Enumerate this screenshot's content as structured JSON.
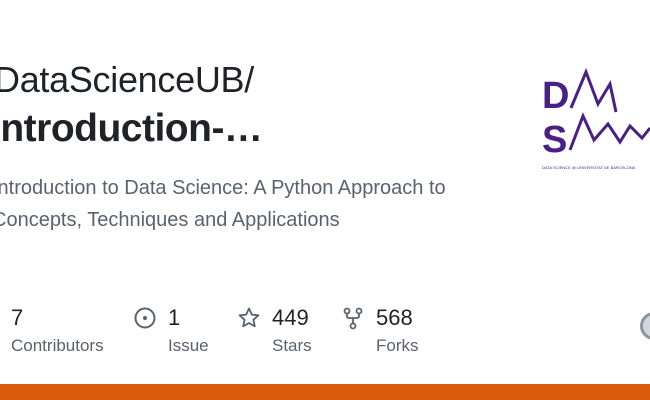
{
  "repo": {
    "owner": "DataScienceUB/",
    "name": "Introduction-…",
    "description": "Introduction to Data Science: A Python Approach to Concepts, Techniques and Applications"
  },
  "logo": {
    "letters": [
      "D",
      "S"
    ],
    "caption": "DATA SCIENCE @ UNIVERSITAT DE BARCELONA",
    "color": "#4a1f86"
  },
  "stats": [
    {
      "value": "7",
      "label": "Contributors",
      "icon": "people-icon"
    },
    {
      "value": "1",
      "label": "Issue",
      "icon": "issue-icon"
    },
    {
      "value": "449",
      "label": "Stars",
      "icon": "star-icon"
    },
    {
      "value": "568",
      "label": "Forks",
      "icon": "fork-icon"
    }
  ],
  "colors": {
    "accent_bar": "#da5b0b",
    "text": "#1f2328",
    "muted": "#59636e"
  }
}
